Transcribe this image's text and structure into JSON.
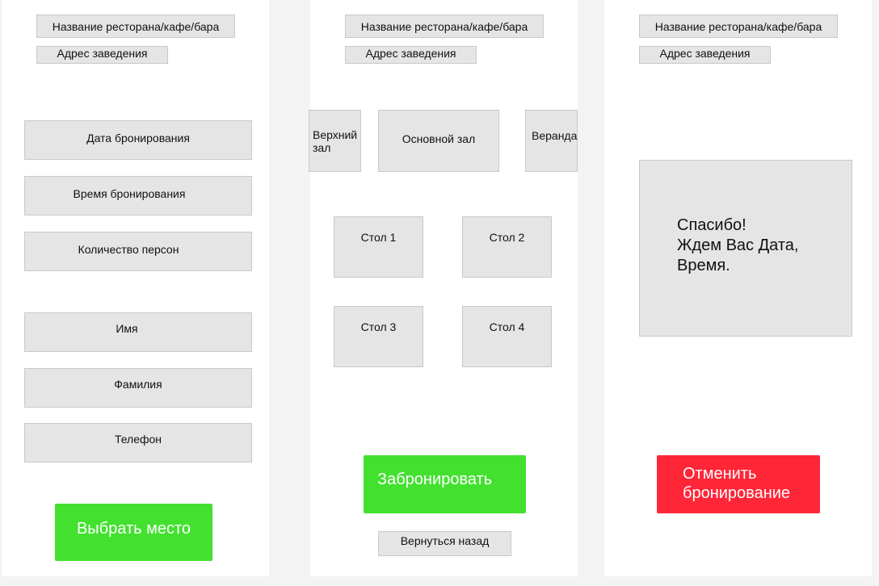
{
  "screen1": {
    "restaurant_name": "Название ресторана/кафе/бара",
    "address": "Адрес заведения",
    "fields": {
      "date": "Дата бронирования",
      "time": "Время бронирования",
      "persons": "Количество персон",
      "first_name": "Имя",
      "last_name": "Фамилия",
      "phone": "Телефон"
    },
    "choose_button": "Выбрать место"
  },
  "screen2": {
    "restaurant_name": "Название ресторана/кафе/бара",
    "address": "Адрес заведения",
    "halls": {
      "upper_line1": "Верхний",
      "upper_line2": "зал",
      "main": "Основной зал",
      "veranda": "Веранда"
    },
    "tables": [
      "Стол 1",
      "Стол 2",
      "Стол 3",
      "Стол 4"
    ],
    "book_button": "Забронировать",
    "back_button": "Вернуться назад"
  },
  "screen3": {
    "restaurant_name": "Название ресторана/кафе/бара",
    "address": "Адрес заведения",
    "thanks": {
      "line1": "Спасибо!",
      "line2": "Ждем Вас Дата,",
      "line3": "Время."
    },
    "cancel_line1": "Отменить",
    "cancel_line2": "бронирование"
  },
  "colors": {
    "green": "#43e030",
    "red": "#ff2638",
    "box": "#e5e5e5"
  }
}
